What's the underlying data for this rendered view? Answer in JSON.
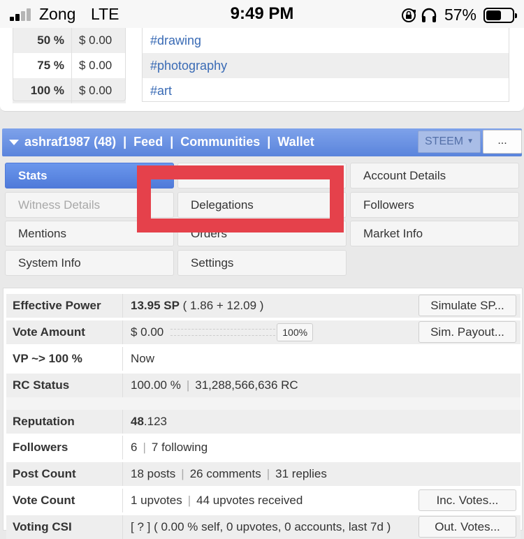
{
  "status_bar": {
    "carrier": "Zong",
    "network": "LTE",
    "time": "9:49 PM",
    "battery_pct": "57%",
    "battery_level": 0.57,
    "icons": [
      "signal-icon",
      "rotation-lock-icon",
      "headphones-icon",
      "battery-icon"
    ]
  },
  "payout_table": [
    {
      "pct": "50 %",
      "value": "$ 0.00"
    },
    {
      "pct": "75 %",
      "value": "$ 0.00"
    },
    {
      "pct": "100 %",
      "value": "$ 0.00"
    }
  ],
  "tags": [
    "#drawing",
    "#photography",
    "#art"
  ],
  "nav": {
    "user": "ashraf1987 (48)",
    "sep": "|",
    "feed": "Feed",
    "communities": "Communities",
    "wallet": "Wallet",
    "currency": "STEEM",
    "more": "..."
  },
  "menu": {
    "stats": "Stats",
    "account_details": "Account Details",
    "witness_details": "Witness Details",
    "delegations": "Delegations",
    "followers": "Followers",
    "mentions": "Mentions",
    "orders": "Orders",
    "market_info": "Market Info",
    "system_info": "System Info",
    "settings": "Settings"
  },
  "stats": {
    "effective_power": {
      "label": "Effective Power",
      "sp": "13.95 SP",
      "detail": " ( 1.86 + 12.09 )",
      "button": "Simulate SP..."
    },
    "vote_amount": {
      "label": "Vote Amount",
      "value": "$ 0.00",
      "pct": "100%",
      "button": "Sim. Payout..."
    },
    "vp": {
      "label": "VP ~> 100 %",
      "value": "Now"
    },
    "rc": {
      "label": "RC Status",
      "pct": "100.00 %",
      "sep": "|",
      "rc": "31,288,566,636 RC"
    },
    "reputation": {
      "label": "Reputation",
      "main": "48",
      "decimal": ".123"
    },
    "followers": {
      "label": "Followers",
      "count": "6",
      "sep": "|",
      "following": "7 following"
    },
    "post_count": {
      "label": "Post Count",
      "posts": "18 posts",
      "sep": "|",
      "comments": "26 comments",
      "replies": "31 replies"
    },
    "vote_count": {
      "label": "Vote Count",
      "upvotes": "1 upvotes",
      "sep": "|",
      "received": "44 upvotes received",
      "button": "Inc. Votes..."
    },
    "voting_csi": {
      "label": "Voting CSI",
      "value": "[ ? ] ( 0.00 % self, 0 upvotes, 0 accounts, last 7d )",
      "button": "Out. Votes..."
    }
  }
}
